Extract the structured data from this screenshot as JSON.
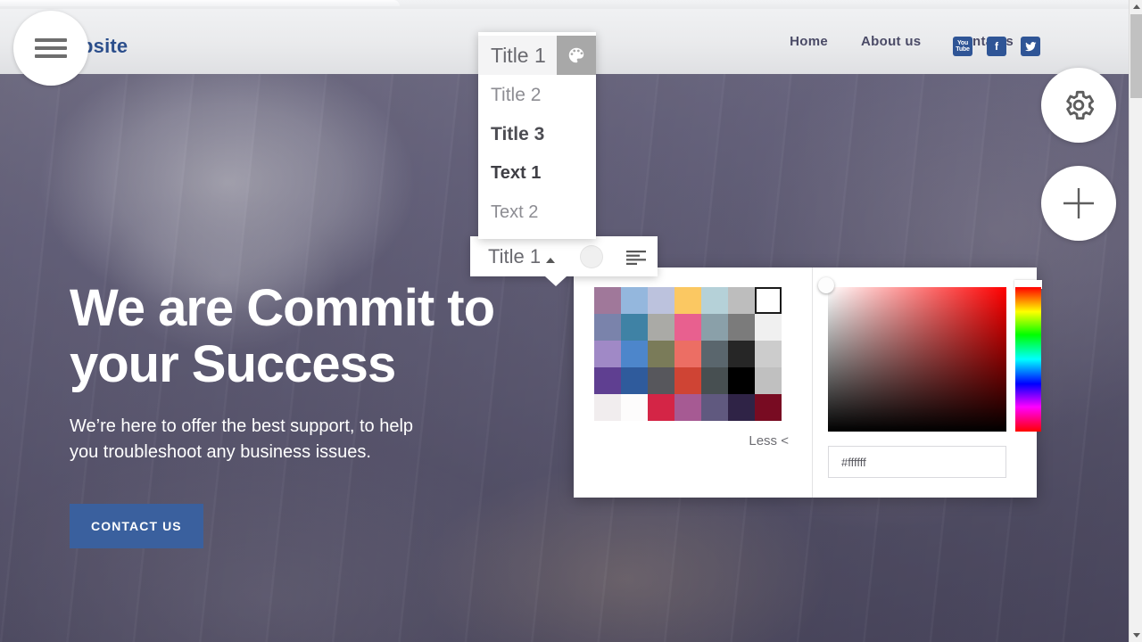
{
  "site": {
    "brand": "Website",
    "nav": [
      {
        "label": "Home"
      },
      {
        "label": "About us"
      },
      {
        "label": "Contacts"
      }
    ],
    "socials": [
      {
        "name": "youtube-icon",
        "glyph_top": "You",
        "glyph_bottom": "Tube"
      },
      {
        "name": "facebook-icon",
        "glyph": "f"
      },
      {
        "name": "twitter-icon",
        "glyph": "ᵗ"
      }
    ],
    "brand_color": "#2b4e8c",
    "nav_color": "#4a4a66",
    "social_tile_color": "#2f5596"
  },
  "hero": {
    "title_line1": "We are Commit to",
    "title_line2": "your Success",
    "subtitle_line1": "We’re here to offer the best support, to help",
    "subtitle_line2": "you troubleshoot any business issues.",
    "cta_label": "CONTACT US",
    "cta_color": "#3a609e",
    "text_color": "#ffffff"
  },
  "editor_fabs": {
    "menu_label": "menu",
    "settings_label": "settings",
    "add_label": "add block"
  },
  "style_menu": {
    "items": [
      {
        "label": "Title 1",
        "active": true
      },
      {
        "label": "Title 2",
        "active": false
      },
      {
        "label": "Title 3",
        "active": false
      },
      {
        "label": "Text 1",
        "active": false
      },
      {
        "label": "Text 2",
        "active": false
      }
    ],
    "palette_chip_icon": "palette-icon",
    "palette_chip_color": "#a8a8a8"
  },
  "text_toolbar": {
    "style_label": "Title 1",
    "caret_icon": "caret-up-icon",
    "color_swatch_value": "#f0f0f0",
    "align_icon": "align-left-icon"
  },
  "color_picker": {
    "less_label": "Less <",
    "hex_value": "#ffffff",
    "hex_placeholder": "#ffffff",
    "selected_swatch_index": 6,
    "swatches": [
      "#a0789a",
      "#94b7dd",
      "#bcc2dd",
      "#fbc862",
      "#b5d1d8",
      "#bdbdbd",
      "#ffffff",
      "#7a83ab",
      "#3f82a5",
      "#aaaaa6",
      "#e8608f",
      "#8aa0a9",
      "#7b7b7b",
      "#f0f0f0",
      "#a089c6",
      "#4d86cb",
      "#7a7b59",
      "#ec6e64",
      "#5a666d",
      "#262626",
      "#cccccc",
      "#5f3f91",
      "#2f5b9c",
      "#57575c",
      "#cf4434",
      "#474f51",
      "#000000",
      "#c0c0c0",
      "#f1edee",
      "#fdfcfc",
      "#d42546",
      "#a65a93",
      "#60597f",
      "#2f2346",
      "#780b22"
    ],
    "hue_position_label": "0",
    "sv_handle_label": "saturation-value-handle"
  },
  "scrollbar": {
    "up_arrow": "scroll-up-arrow",
    "down_arrow": "scroll-down-arrow",
    "thumb": "scroll-thumb"
  }
}
